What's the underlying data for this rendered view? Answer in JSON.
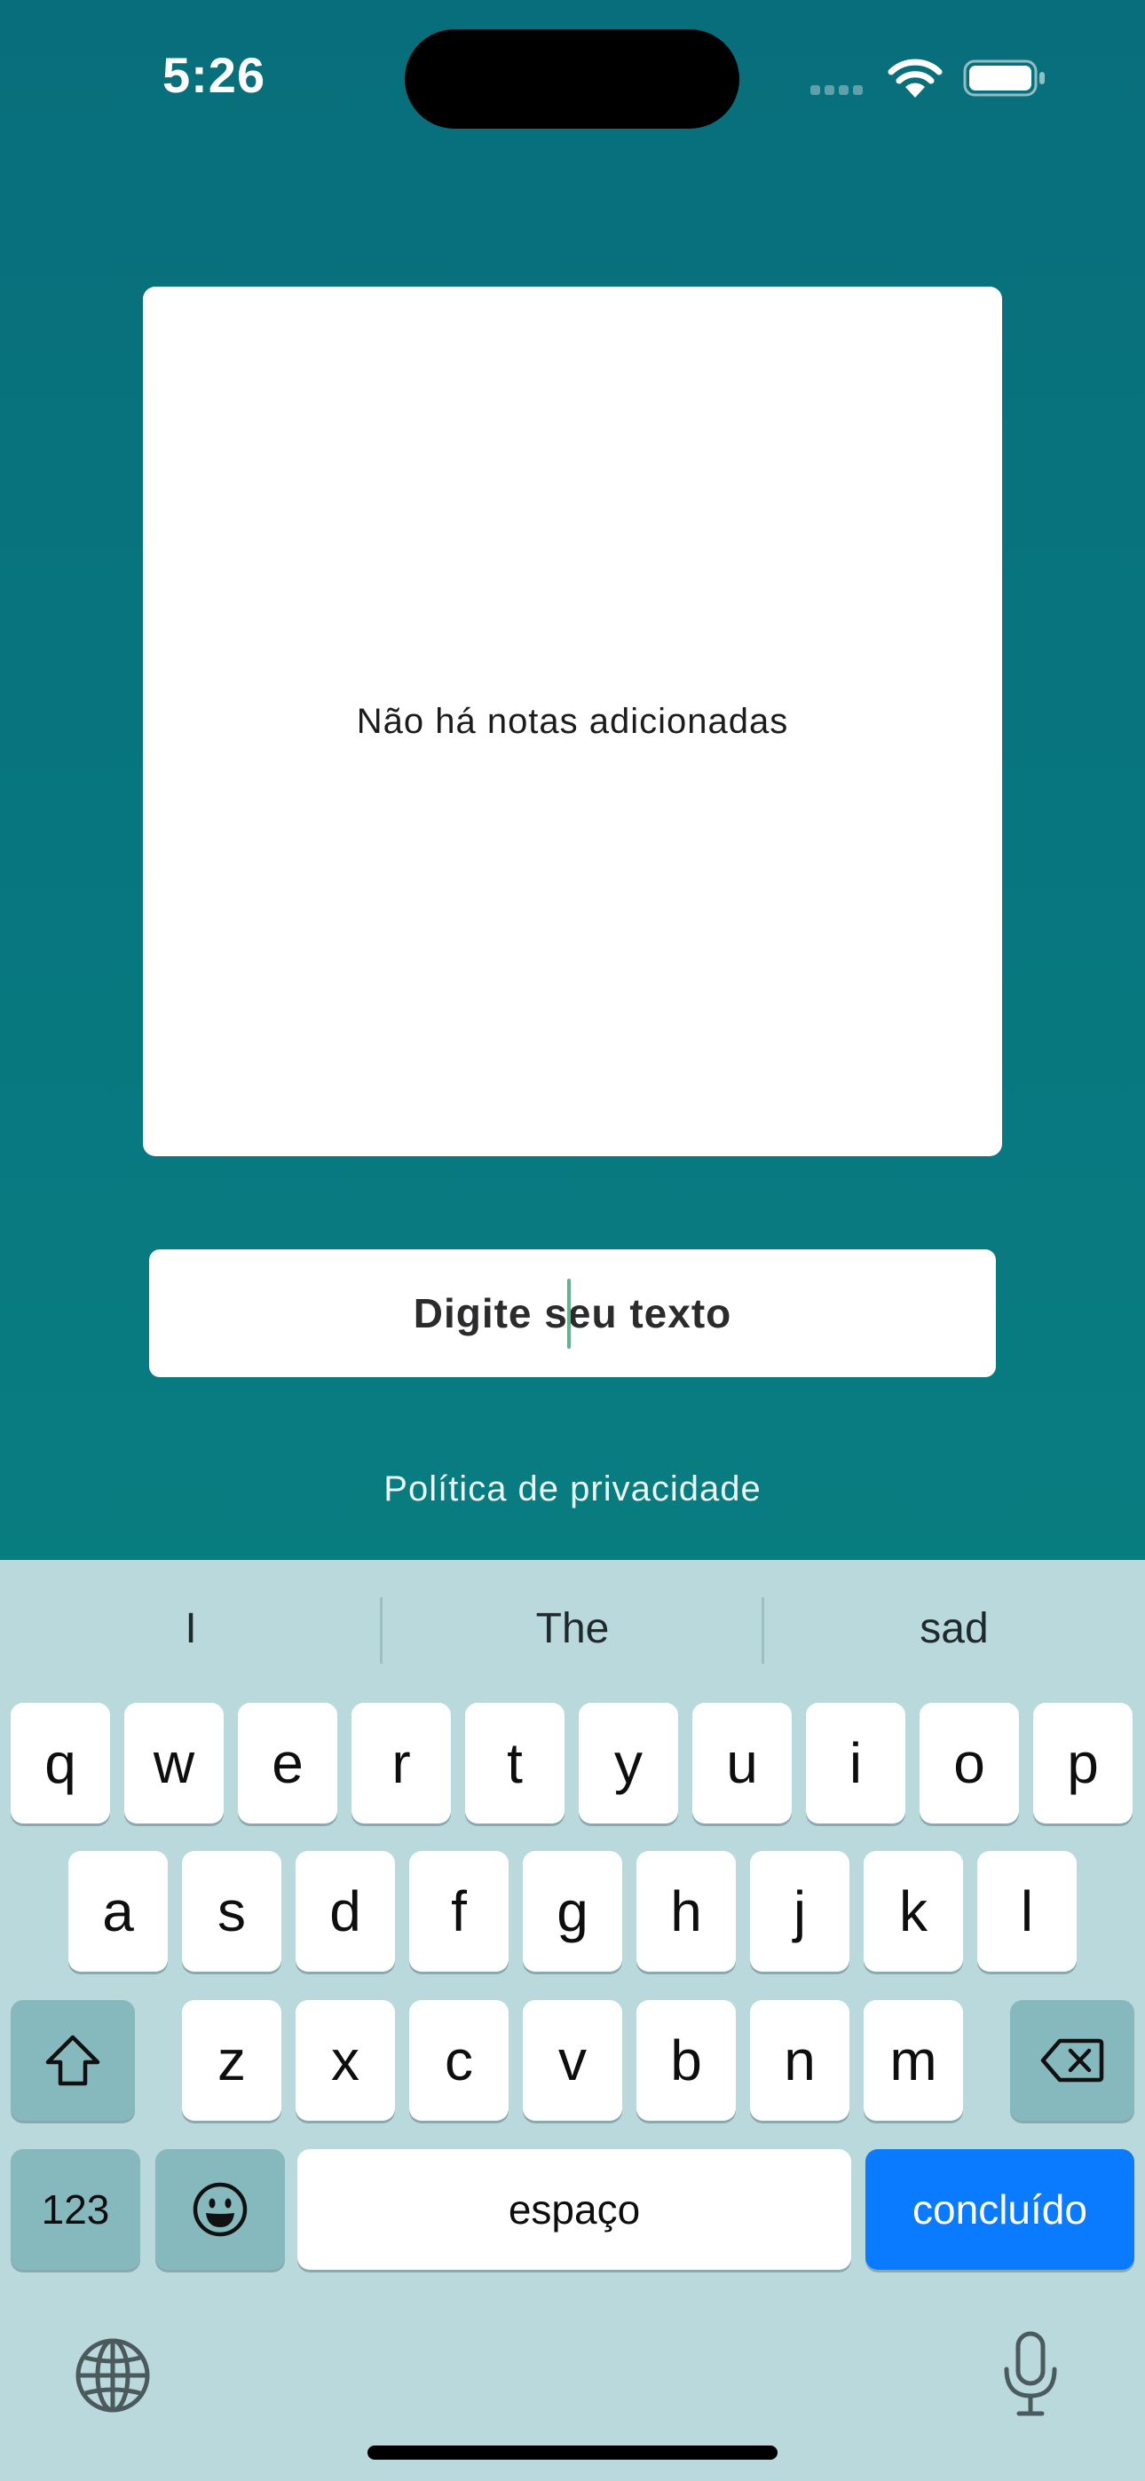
{
  "status_bar": {
    "time": "5:26"
  },
  "notes": {
    "empty_message": "Não há notas adicionadas"
  },
  "input": {
    "value": "Digite seu texto"
  },
  "privacy_link": "Política de privacidade",
  "keyboard": {
    "suggestions": [
      "I",
      "The",
      "sad"
    ],
    "row1": [
      "q",
      "w",
      "e",
      "r",
      "t",
      "y",
      "u",
      "i",
      "o",
      "p"
    ],
    "row2": [
      "a",
      "s",
      "d",
      "f",
      "g",
      "h",
      "j",
      "k",
      "l"
    ],
    "row3": [
      "z",
      "x",
      "c",
      "v",
      "b",
      "n",
      "m"
    ],
    "numbers_label": "123",
    "space_label": "espaço",
    "done_label": "concluído",
    "done_color": "#0a7aff"
  },
  "colors": {
    "background_top": "#086e7b",
    "background_bottom": "#06857d",
    "keyboard_bg": "#bad9dd",
    "caret": "#5fb38f"
  }
}
